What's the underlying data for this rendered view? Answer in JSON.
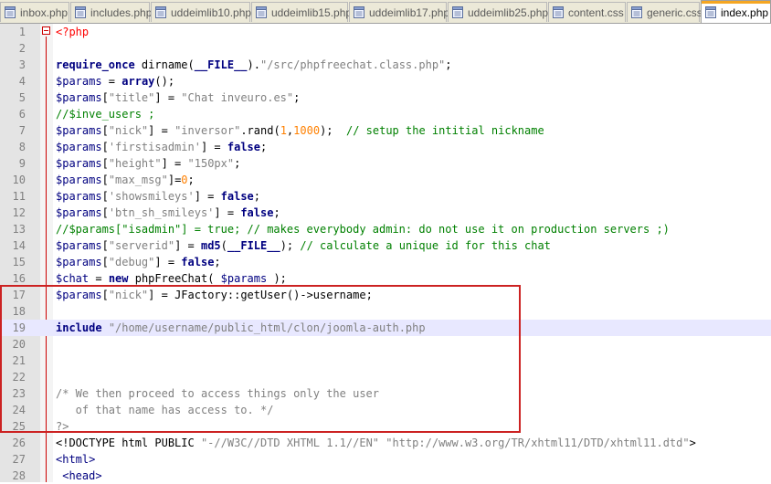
{
  "tabs": [
    {
      "label": "inbox.php",
      "active": false
    },
    {
      "label": "includes.php",
      "active": false
    },
    {
      "label": "uddeimlib10.php",
      "active": false
    },
    {
      "label": "uddeimlib15.php",
      "active": false
    },
    {
      "label": "uddeimlib17.php",
      "active": false
    },
    {
      "label": "uddeimlib25.php",
      "active": false
    },
    {
      "label": "content.css",
      "active": false
    },
    {
      "label": "generic.css",
      "active": false
    },
    {
      "label": "index.php",
      "active": true
    }
  ],
  "lines": [
    {
      "n": "1",
      "tokens": [
        [
          "php",
          "<?php"
        ]
      ]
    },
    {
      "n": "2",
      "tokens": []
    },
    {
      "n": "3",
      "tokens": [
        [
          "kw",
          "require_once"
        ],
        [
          "dflt",
          " dirname("
        ],
        [
          "kw",
          "__FILE__"
        ],
        [
          "dflt",
          ")."
        ],
        [
          "str",
          "\"/src/phpfreechat.class.php\""
        ],
        [
          "dflt",
          ";"
        ]
      ]
    },
    {
      "n": "4",
      "tokens": [
        [
          "var",
          "$params"
        ],
        [
          "dflt",
          " = "
        ],
        [
          "kw",
          "array"
        ],
        [
          "dflt",
          "();"
        ]
      ]
    },
    {
      "n": "5",
      "tokens": [
        [
          "var",
          "$params"
        ],
        [
          "dflt",
          "["
        ],
        [
          "str",
          "\"title\""
        ],
        [
          "dflt",
          "] = "
        ],
        [
          "str",
          "\"Chat inveuro.es\""
        ],
        [
          "dflt",
          ";"
        ]
      ]
    },
    {
      "n": "6",
      "tokens": [
        [
          "cmt",
          "//$inve_users ;"
        ]
      ]
    },
    {
      "n": "7",
      "tokens": [
        [
          "var",
          "$params"
        ],
        [
          "dflt",
          "["
        ],
        [
          "str",
          "\"nick\""
        ],
        [
          "dflt",
          "] = "
        ],
        [
          "str",
          "\"inversor\""
        ],
        [
          "dflt",
          ".rand("
        ],
        [
          "num",
          "1"
        ],
        [
          "dflt",
          ","
        ],
        [
          "num",
          "1000"
        ],
        [
          "dflt",
          ");  "
        ],
        [
          "cmt",
          "// setup the intitial nickname"
        ]
      ]
    },
    {
      "n": "8",
      "tokens": [
        [
          "var",
          "$params"
        ],
        [
          "dflt",
          "["
        ],
        [
          "str",
          "'firstisadmin'"
        ],
        [
          "dflt",
          "] = "
        ],
        [
          "kw",
          "false"
        ],
        [
          "dflt",
          ";"
        ]
      ]
    },
    {
      "n": "9",
      "tokens": [
        [
          "var",
          "$params"
        ],
        [
          "dflt",
          "["
        ],
        [
          "str",
          "\"height\""
        ],
        [
          "dflt",
          "] = "
        ],
        [
          "str",
          "\"150px\""
        ],
        [
          "dflt",
          ";"
        ]
      ]
    },
    {
      "n": "10",
      "tokens": [
        [
          "var",
          "$params"
        ],
        [
          "dflt",
          "["
        ],
        [
          "str",
          "\"max_msg\""
        ],
        [
          "dflt",
          "]="
        ],
        [
          "num",
          "0"
        ],
        [
          "dflt",
          ";"
        ]
      ]
    },
    {
      "n": "11",
      "tokens": [
        [
          "var",
          "$params"
        ],
        [
          "dflt",
          "["
        ],
        [
          "str",
          "'showsmileys'"
        ],
        [
          "dflt",
          "] = "
        ],
        [
          "kw",
          "false"
        ],
        [
          "dflt",
          ";"
        ]
      ]
    },
    {
      "n": "12",
      "tokens": [
        [
          "var",
          "$params"
        ],
        [
          "dflt",
          "["
        ],
        [
          "str",
          "'btn_sh_smileys'"
        ],
        [
          "dflt",
          "] = "
        ],
        [
          "kw",
          "false"
        ],
        [
          "dflt",
          ";"
        ]
      ]
    },
    {
      "n": "13",
      "tokens": [
        [
          "cmt",
          "//$params[\"isadmin\"] = true; // makes everybody admin: do not use it on production servers ;)"
        ]
      ]
    },
    {
      "n": "14",
      "tokens": [
        [
          "var",
          "$params"
        ],
        [
          "dflt",
          "["
        ],
        [
          "str",
          "\"serverid\""
        ],
        [
          "dflt",
          "] = "
        ],
        [
          "kw",
          "md5"
        ],
        [
          "dflt",
          "("
        ],
        [
          "kw",
          "__FILE__"
        ],
        [
          "dflt",
          "); "
        ],
        [
          "cmt",
          "// calculate a unique id for this chat"
        ]
      ]
    },
    {
      "n": "15",
      "tokens": [
        [
          "var",
          "$params"
        ],
        [
          "dflt",
          "["
        ],
        [
          "str",
          "\"debug\""
        ],
        [
          "dflt",
          "] = "
        ],
        [
          "kw",
          "false"
        ],
        [
          "dflt",
          ";"
        ]
      ]
    },
    {
      "n": "16",
      "tokens": [
        [
          "var",
          "$chat"
        ],
        [
          "dflt",
          " = "
        ],
        [
          "kw",
          "new"
        ],
        [
          "dflt",
          " phpFreeChat( "
        ],
        [
          "var",
          "$params"
        ],
        [
          "dflt",
          " );"
        ]
      ]
    },
    {
      "n": "17",
      "tokens": [
        [
          "var",
          "$params"
        ],
        [
          "dflt",
          "["
        ],
        [
          "str",
          "\"nick\""
        ],
        [
          "dflt",
          "] = JFactory::getUser()->username;"
        ]
      ]
    },
    {
      "n": "18",
      "tokens": []
    },
    {
      "n": "19",
      "tokens": [
        [
          "kw",
          "include"
        ],
        [
          "dflt",
          " "
        ],
        [
          "str",
          "\"/home/username/public_html/clon/joomla-auth.php"
        ]
      ],
      "current": true
    },
    {
      "n": "20",
      "tokens": []
    },
    {
      "n": "21",
      "tokens": []
    },
    {
      "n": "22",
      "tokens": []
    },
    {
      "n": "23",
      "tokens": [
        [
          "blk",
          "/* We then proceed to access things only the user"
        ]
      ]
    },
    {
      "n": "24",
      "tokens": [
        [
          "blk",
          "   of that name has access to. */"
        ]
      ]
    },
    {
      "n": "25",
      "tokens": [
        [
          "blk",
          "?>"
        ]
      ]
    },
    {
      "n": "26",
      "tokens": [
        [
          "dflt",
          "<!DOCTYPE html PUBLIC "
        ],
        [
          "str",
          "\"-//W3C//DTD XHTML 1.1//EN\""
        ],
        [
          "dflt",
          " "
        ],
        [
          "str",
          "\"http://www.w3.org/TR/xhtml11/DTD/xhtml11.dtd\""
        ],
        [
          "dflt",
          ">"
        ]
      ]
    },
    {
      "n": "27",
      "tokens": [
        [
          "html",
          "<html>"
        ]
      ]
    },
    {
      "n": "28",
      "tokens": [
        [
          "html",
          " <head>"
        ]
      ]
    }
  ],
  "colors": {
    "highlight_border": "#cc2222",
    "current_line": "#e8e8ff",
    "active_tab_accent": "#f5a623"
  }
}
